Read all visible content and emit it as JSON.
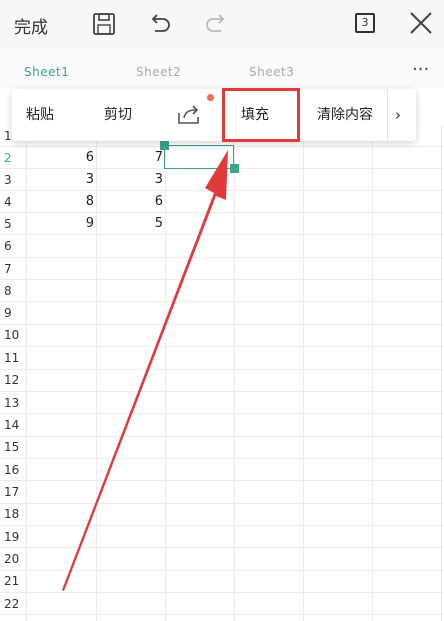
{
  "toolbar": {
    "done_label": "完成",
    "sheet_count": "3"
  },
  "tabs": [
    {
      "label": "Sheet1",
      "active": true
    },
    {
      "label": "Sheet2",
      "active": false
    },
    {
      "label": "Sheet3",
      "active": false
    }
  ],
  "context_menu": {
    "items": {
      "paste": "粘贴",
      "cut": "剪切",
      "fill": "填充",
      "clear": "清除内容"
    },
    "highlight_color": "#e23a3a",
    "badge_color": "#f06a55"
  },
  "rows": [
    "1",
    "2",
    "3",
    "4",
    "5",
    "6",
    "7",
    "8",
    "9",
    "10",
    "11",
    "12",
    "13",
    "14",
    "15",
    "16",
    "17",
    "18",
    "19",
    "20",
    "21",
    "22"
  ],
  "cells": {
    "r2": {
      "a": "6",
      "b": "7"
    },
    "r3": {
      "a": "3",
      "b": "3"
    },
    "r4": {
      "a": "8",
      "b": "6"
    },
    "r5": {
      "a": "9",
      "b": "5"
    }
  },
  "colors": {
    "accent": "#3aa58e",
    "annotation": "#e23a3a"
  },
  "icons": [
    "save-icon",
    "undo-icon",
    "redo-icon",
    "close-icon",
    "more-icon",
    "share-icon",
    "chevron-right-icon"
  ]
}
